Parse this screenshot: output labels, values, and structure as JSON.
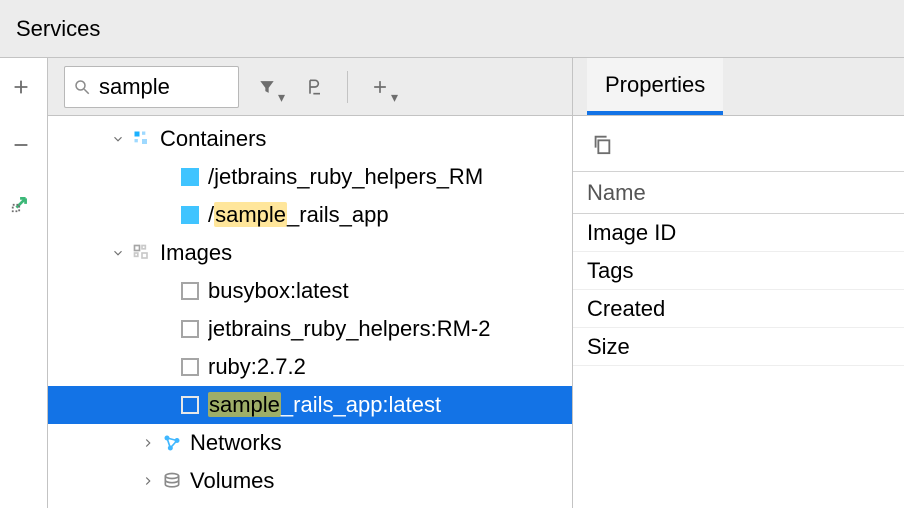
{
  "title": "Services",
  "search": {
    "value": "sample",
    "placeholder": ""
  },
  "tree": {
    "containers": {
      "label": "Containers",
      "items": [
        {
          "pre": "/jetbrains_ruby_helpers_RM",
          "hl": "",
          "post": ""
        },
        {
          "pre": "/",
          "hl": "sample",
          "post": "_rails_app"
        }
      ]
    },
    "images": {
      "label": "Images",
      "items": [
        {
          "pre": "busybox:latest",
          "hl": "",
          "post": ""
        },
        {
          "pre": "jetbrains_ruby_helpers:RM-2",
          "hl": "",
          "post": ""
        },
        {
          "pre": "ruby:2.7.2",
          "hl": "",
          "post": ""
        },
        {
          "pre": "",
          "hl": "sample",
          "post": "_rails_app:latest",
          "selected": true
        }
      ]
    },
    "networks": {
      "label": "Networks"
    },
    "volumes": {
      "label": "Volumes"
    }
  },
  "props": {
    "tab": "Properties",
    "name_header": "Name",
    "keys": [
      "Image ID",
      "Tags",
      "Created",
      "Size"
    ]
  }
}
